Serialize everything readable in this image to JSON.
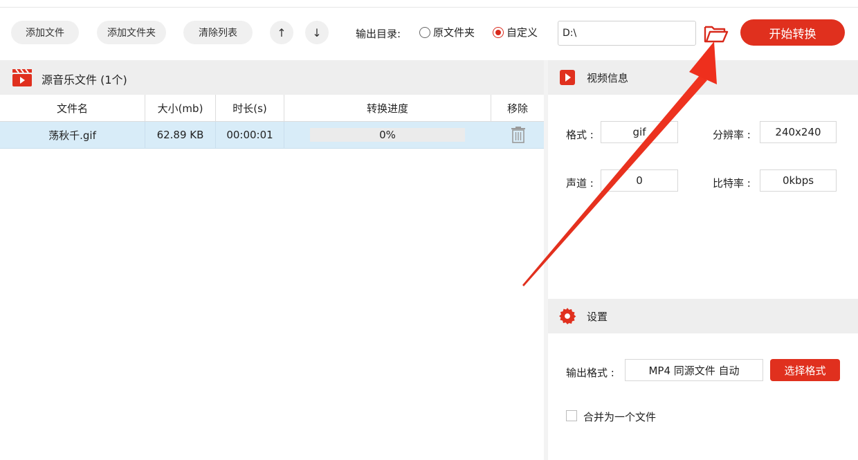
{
  "toolbar": {
    "add_file": "添加文件",
    "add_folder": "添加文件夹",
    "clear_list": "清除列表",
    "move_up_glyph": "↑",
    "move_down_glyph": "↓",
    "output_dir_label": "输出目录:",
    "radio_original": "原文件夹",
    "radio_custom": "自定义",
    "selected_radio": "custom",
    "path_value": "D:\\",
    "start_button": "开始转换"
  },
  "file_list": {
    "title": "源音乐文件 (1个)",
    "columns": [
      "文件名",
      "大小(mb)",
      "时长(s)",
      "转换进度",
      "移除"
    ],
    "rows": [
      {
        "name": "荡秋千.gif",
        "size": "62.89 KB",
        "duration": "00:00:01",
        "progress_percent": 0,
        "progress_text": "0%"
      }
    ]
  },
  "video_info": {
    "title": "视频信息",
    "format_label": "格式 :",
    "format_value": "gif",
    "resolution_label": "分辨率 :",
    "resolution_value": "240x240",
    "channel_label": "声道 :",
    "channel_value": "0",
    "bitrate_label": "比特率 :",
    "bitrate_value": "0kbps"
  },
  "settings": {
    "title": "设置",
    "output_format_label": "输出格式 :",
    "output_format_value": "MP4 同源文件 自动",
    "select_format_button": "选择格式",
    "merge_label": "合并为一个文件",
    "merge_checked": false
  },
  "colors": {
    "accent_red": "#e0301e",
    "selected_row": "#d8ecf8",
    "header_gray": "#eeeeee"
  },
  "icons": {
    "source_header": "film-clapper-icon",
    "video_info": "play-icon",
    "settings": "gear-icon",
    "browse": "folder-open-icon",
    "remove": "trash-icon"
  }
}
